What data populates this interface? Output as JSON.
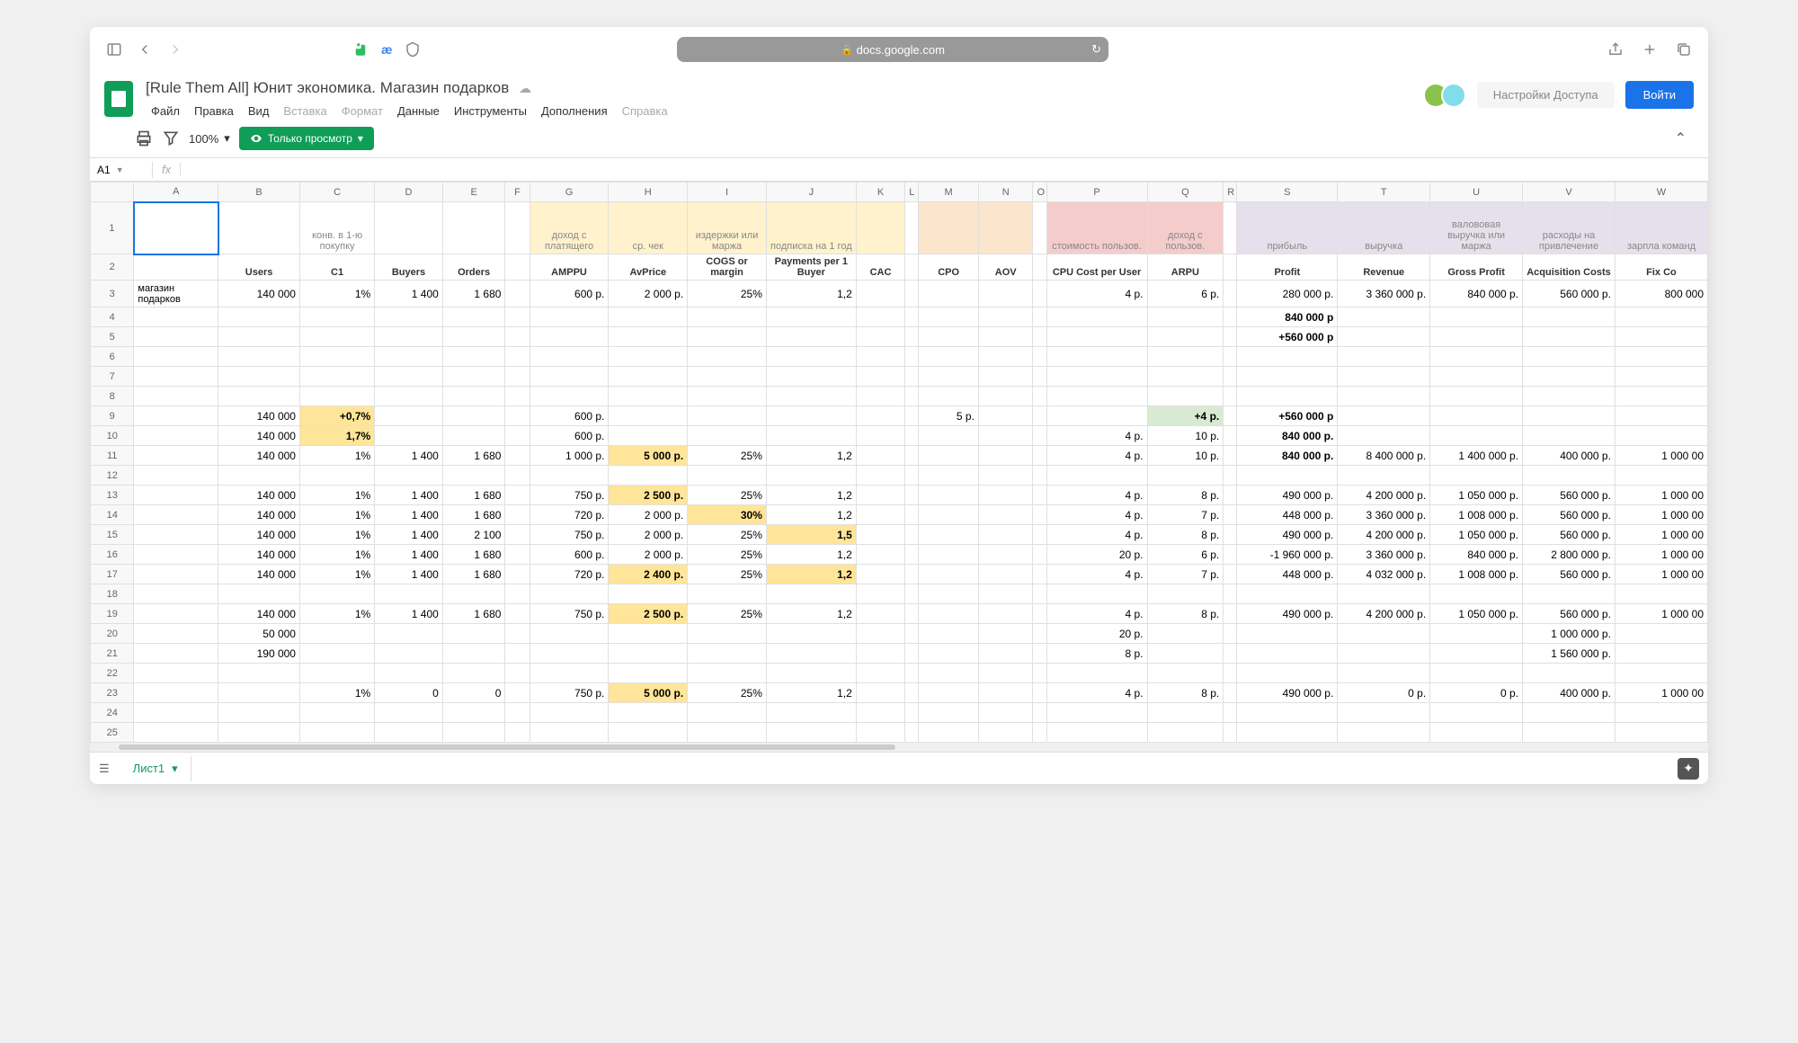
{
  "browser": {
    "url": "docs.google.com"
  },
  "doc": {
    "title": "[Rule Them All] Юнит экономика. Магазин подарков",
    "menu": [
      "Файл",
      "Правка",
      "Вид",
      "Вставка",
      "Формат",
      "Данные",
      "Инструменты",
      "Дополнения",
      "Справка"
    ],
    "menu_disabled": [
      3,
      4,
      8
    ],
    "access_btn": "Настройки Доступа",
    "login_btn": "Войти",
    "zoom": "100%",
    "view_mode": "Только просмотр",
    "cell_ref": "A1",
    "sheet_tab": "Лист1"
  },
  "cols": [
    "",
    "A",
    "B",
    "C",
    "D",
    "E",
    "F",
    "G",
    "H",
    "I",
    "J",
    "K",
    "L",
    "M",
    "N",
    "O",
    "P",
    "Q",
    "R",
    "S",
    "T",
    "U",
    "V",
    "W"
  ],
  "header1": {
    "C": "конв. в 1-ю покупку",
    "G": "доход с платящего",
    "H": "ср. чек",
    "I": "издержки или маржа",
    "J": "подписка на 1 год",
    "P": "стоимость пользов.",
    "Q": "доход с пользов.",
    "S": "прибыль",
    "T": "выручка",
    "U": "валововая выручка или маржа",
    "V": "расходы на привлечение",
    "W": "зарпла команд"
  },
  "header2": {
    "B": "Users",
    "C": "C1",
    "D": "Buyers",
    "E": "Orders",
    "G": "AMPPU",
    "H": "AvPrice",
    "I": "COGS or margin",
    "J": "Payments per 1 Buyer",
    "K": "CAC",
    "M": "CPO",
    "N": "AOV",
    "P": "CPU Cost per User",
    "Q": "ARPU",
    "S": "Profit",
    "T": "Revenue",
    "U": "Gross Profit",
    "V": "Acquisition Costs",
    "W": "Fix Co"
  },
  "rows": [
    {
      "n": 3,
      "A": "магазин подарков",
      "B": "140 000",
      "C": "1%",
      "D": "1 400",
      "E": "1 680",
      "G": "600 р.",
      "H": "2 000 р.",
      "I": "25%",
      "J": "1,2",
      "P": "4 р.",
      "Q": "6 р.",
      "S": "280 000 р.",
      "T": "3 360 000 р.",
      "U": "840 000 р.",
      "V": "560 000 р.",
      "W": "800 000"
    },
    {
      "n": 4,
      "S": "840 000 р"
    },
    {
      "n": 5,
      "S": "+560 000 р"
    },
    {
      "n": 6
    },
    {
      "n": 7
    },
    {
      "n": 8
    },
    {
      "n": 9,
      "B": "140 000",
      "C": "+0,7%",
      "G": "600 р.",
      "M": "5 р.",
      "Q": "+4 р.",
      "S": "+560 000 р"
    },
    {
      "n": 10,
      "B": "140 000",
      "C": "1,7%",
      "G": "600 р.",
      "P": "4 р.",
      "Q": "10 р.",
      "S": "840 000 р."
    },
    {
      "n": 11,
      "B": "140 000",
      "C": "1%",
      "D": "1 400",
      "E": "1 680",
      "G": "1 000 р.",
      "H": "5 000 р.",
      "I": "25%",
      "J": "1,2",
      "P": "4 р.",
      "Q": "10 р.",
      "S": "840 000 р.",
      "T": "8 400 000 р.",
      "U": "1 400 000 р.",
      "V": "400 000 р.",
      "W": "1 000 00"
    },
    {
      "n": 12
    },
    {
      "n": 13,
      "B": "140 000",
      "C": "1%",
      "D": "1 400",
      "E": "1 680",
      "G": "750 р.",
      "H": "2 500 р.",
      "I": "25%",
      "J": "1,2",
      "P": "4 р.",
      "Q": "8 р.",
      "S": "490 000 р.",
      "T": "4 200 000 р.",
      "U": "1 050 000 р.",
      "V": "560 000 р.",
      "W": "1 000 00"
    },
    {
      "n": 14,
      "B": "140 000",
      "C": "1%",
      "D": "1 400",
      "E": "1 680",
      "G": "720 р.",
      "H": "2 000 р.",
      "I": "30%",
      "J": "1,2",
      "P": "4 р.",
      "Q": "7 р.",
      "S": "448 000 р.",
      "T": "3 360 000 р.",
      "U": "1 008 000 р.",
      "V": "560 000 р.",
      "W": "1 000 00"
    },
    {
      "n": 15,
      "B": "140 000",
      "C": "1%",
      "D": "1 400",
      "E": "2 100",
      "G": "750 р.",
      "H": "2 000 р.",
      "I": "25%",
      "J": "1,5",
      "P": "4 р.",
      "Q": "8 р.",
      "S": "490 000 р.",
      "T": "4 200 000 р.",
      "U": "1 050 000 р.",
      "V": "560 000 р.",
      "W": "1 000 00"
    },
    {
      "n": 16,
      "B": "140 000",
      "C": "1%",
      "D": "1 400",
      "E": "1 680",
      "G": "600 р.",
      "H": "2 000 р.",
      "I": "25%",
      "J": "1,2",
      "P": "20 р.",
      "Q": "6 р.",
      "S": "-1 960 000 р.",
      "T": "3 360 000 р.",
      "U": "840 000 р.",
      "V": "2 800 000 р.",
      "W": "1 000 00"
    },
    {
      "n": 17,
      "B": "140 000",
      "C": "1%",
      "D": "1 400",
      "E": "1 680",
      "G": "720 р.",
      "H": "2 400 р.",
      "I": "25%",
      "J": "1,2",
      "P": "4 р.",
      "Q": "7 р.",
      "S": "448 000 р.",
      "T": "4 032 000 р.",
      "U": "1 008 000 р.",
      "V": "560 000 р.",
      "W": "1 000 00"
    },
    {
      "n": 18
    },
    {
      "n": 19,
      "B": "140 000",
      "C": "1%",
      "D": "1 400",
      "E": "1 680",
      "G": "750 р.",
      "H": "2 500 р.",
      "I": "25%",
      "J": "1,2",
      "P": "4 р.",
      "Q": "8 р.",
      "S": "490 000 р.",
      "T": "4 200 000 р.",
      "U": "1 050 000 р.",
      "V": "560 000 р.",
      "W": "1 000 00"
    },
    {
      "n": 20,
      "B": "50 000",
      "P": "20 р.",
      "V": "1 000 000 р."
    },
    {
      "n": 21,
      "B": "190 000",
      "P": "8 р.",
      "V": "1 560 000 р."
    },
    {
      "n": 22
    },
    {
      "n": 23,
      "C": "1%",
      "D": "0",
      "E": "0",
      "G": "750 р.",
      "H": "5 000 р.",
      "I": "25%",
      "J": "1,2",
      "P": "4 р.",
      "Q": "8 р.",
      "S": "490 000 р.",
      "T": "0 р.",
      "U": "0 р.",
      "V": "400 000 р.",
      "W": "1 000 00"
    },
    {
      "n": 24
    },
    {
      "n": 25
    }
  ],
  "highlight": {
    "header1_yellow": [
      "G",
      "H",
      "I",
      "J",
      "K"
    ],
    "header1_orange": [
      "M",
      "N"
    ],
    "header1_red": [
      "P",
      "Q"
    ],
    "header1_purple": [
      "S",
      "T",
      "U",
      "V",
      "W"
    ],
    "yellow_cells": [
      [
        "9",
        "C"
      ],
      [
        "10",
        "C"
      ],
      [
        "11",
        "H"
      ],
      [
        "13",
        "H"
      ],
      [
        "14",
        "I"
      ],
      [
        "15",
        "J"
      ],
      [
        "17",
        "H"
      ],
      [
        "17",
        "J"
      ],
      [
        "19",
        "H"
      ],
      [
        "23",
        "H"
      ]
    ],
    "green_cells": [
      [
        "9",
        "Q"
      ]
    ],
    "bold_cells": [
      [
        "4",
        "S"
      ],
      [
        "5",
        "S"
      ],
      [
        "9",
        "C"
      ],
      [
        "9",
        "Q"
      ],
      [
        "9",
        "S"
      ],
      [
        "10",
        "C"
      ],
      [
        "10",
        "S"
      ],
      [
        "11",
        "H"
      ],
      [
        "11",
        "S"
      ],
      [
        "13",
        "H"
      ],
      [
        "14",
        "I"
      ],
      [
        "15",
        "J"
      ],
      [
        "17",
        "H"
      ],
      [
        "17",
        "J"
      ],
      [
        "19",
        "H"
      ],
      [
        "23",
        "H"
      ]
    ]
  }
}
